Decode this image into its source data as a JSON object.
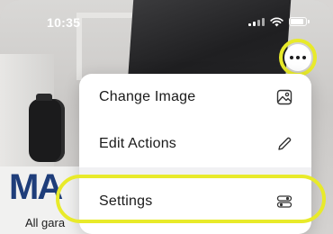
{
  "status_bar": {
    "time": "10:35"
  },
  "background": {
    "logo_text": "MA",
    "tagline": "All gara"
  },
  "more_button": {
    "icon": "more-horizontal-icon"
  },
  "menu": {
    "items": [
      {
        "label": "Change Image",
        "icon": "image-icon"
      },
      {
        "label": "Edit Actions",
        "icon": "pencil-icon"
      },
      {
        "label": "Settings",
        "icon": "settings-toggles-icon"
      }
    ]
  },
  "colors": {
    "highlight": "#e8ea2a",
    "menu_background": "#ffffff",
    "text": "#1a1a1a"
  }
}
